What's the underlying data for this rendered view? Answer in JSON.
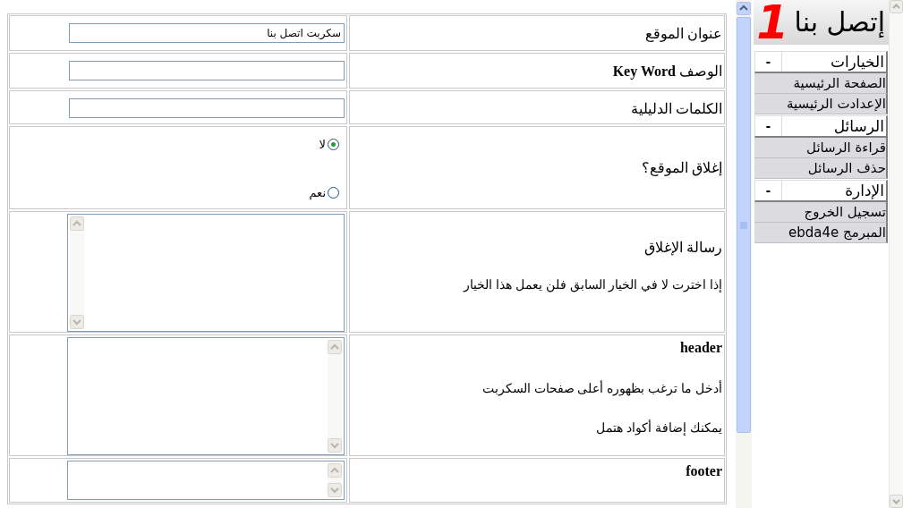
{
  "form": {
    "rows": [
      {
        "kind": "text",
        "label": "عنوان الموقع",
        "value": "سكربت اتصل بنا"
      },
      {
        "kind": "text",
        "label": "الوصف **Key Word**",
        "value": ""
      },
      {
        "kind": "text",
        "label": "الكلمات الدليلية",
        "value": ""
      },
      {
        "kind": "radio",
        "label": "إغلاق الموقع؟",
        "options": [
          {
            "label": "لا",
            "selected": true
          },
          {
            "label": "نعم",
            "selected": false
          }
        ]
      },
      {
        "kind": "textarea",
        "label": "رسالة الإغلاق",
        "notes": [
          "إذا اخترت لا في الخيار السابق فلن يعمل هذا الخيار"
        ]
      },
      {
        "kind": "textarea",
        "label": "header",
        "label_bold": true,
        "notes": [
          "أدخل ما ترغب بظهوره أعلى صفحات السكربت",
          "يمكنك إضافة أكواد هتمل"
        ]
      },
      {
        "kind": "textarea",
        "label": "footer",
        "label_bold": true,
        "notes": []
      }
    ]
  },
  "sidebar": {
    "logo": {
      "number": "1",
      "text": "إتصل بنا"
    },
    "sections": [
      {
        "title": "الخيارات",
        "toggle": "-",
        "items": [
          "الصفحة الرئيسية",
          "الإعدادت الرئيسية"
        ]
      },
      {
        "title": "الرسائل",
        "toggle": "-",
        "items": [
          "قراءة الرسائل",
          "حذف الرسائل"
        ]
      },
      {
        "title": "الإدارة",
        "toggle": "-",
        "items": [
          "تسجيل الخروج",
          "المبرمج ebda4e"
        ]
      }
    ]
  }
}
